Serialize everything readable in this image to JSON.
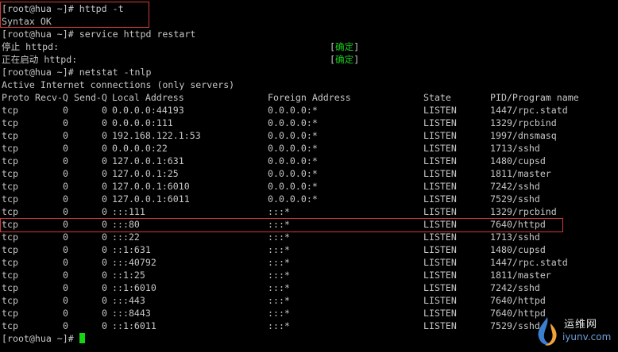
{
  "terminal": {
    "prompt": "[root@hua ~]#",
    "cmd1": "httpd -t",
    "syntax_ok": "Syntax OK",
    "cmd2": "service httpd restart",
    "stop_text": "停止 httpd:",
    "start_text": "正在启动 httpd:",
    "bracket_open": "[",
    "bracket_close": "]",
    "ok_word": "确定",
    "ok_color": "#19c81c",
    "cmd3": "netstat -tnlp",
    "active_text": "Active Internet connections (only servers)",
    "header": {
      "proto": "Proto",
      "recvq": "Recv-Q",
      "sendq": "Send-Q",
      "local": "Local Address",
      "foreign": "Foreign Address",
      "state": "State",
      "pid": "PID/Program name"
    },
    "rows": [
      {
        "proto": "tcp",
        "recv": "0",
        "send": "0",
        "local": "0.0.0.0:44193",
        "foreign": "0.0.0.0:*",
        "state": "LISTEN",
        "pid": "1447/rpc.statd"
      },
      {
        "proto": "tcp",
        "recv": "0",
        "send": "0",
        "local": "0.0.0.0:111",
        "foreign": "0.0.0.0:*",
        "state": "LISTEN",
        "pid": "1329/rpcbind"
      },
      {
        "proto": "tcp",
        "recv": "0",
        "send": "0",
        "local": "192.168.122.1:53",
        "foreign": "0.0.0.0:*",
        "state": "LISTEN",
        "pid": "1997/dnsmasq"
      },
      {
        "proto": "tcp",
        "recv": "0",
        "send": "0",
        "local": "0.0.0.0:22",
        "foreign": "0.0.0.0:*",
        "state": "LISTEN",
        "pid": "1713/sshd"
      },
      {
        "proto": "tcp",
        "recv": "0",
        "send": "0",
        "local": "127.0.0.1:631",
        "foreign": "0.0.0.0:*",
        "state": "LISTEN",
        "pid": "1480/cupsd"
      },
      {
        "proto": "tcp",
        "recv": "0",
        "send": "0",
        "local": "127.0.0.1:25",
        "foreign": "0.0.0.0:*",
        "state": "LISTEN",
        "pid": "1811/master"
      },
      {
        "proto": "tcp",
        "recv": "0",
        "send": "0",
        "local": "127.0.0.1:6010",
        "foreign": "0.0.0.0:*",
        "state": "LISTEN",
        "pid": "7242/sshd"
      },
      {
        "proto": "tcp",
        "recv": "0",
        "send": "0",
        "local": "127.0.0.1:6011",
        "foreign": "0.0.0.0:*",
        "state": "LISTEN",
        "pid": "7529/sshd"
      },
      {
        "proto": "tcp",
        "recv": "0",
        "send": "0",
        "local": ":::111",
        "foreign": ":::*",
        "state": "LISTEN",
        "pid": "1329/rpcbind"
      },
      {
        "proto": "tcp",
        "recv": "0",
        "send": "0",
        "local": ":::80",
        "foreign": ":::*",
        "state": "LISTEN",
        "pid": "7640/httpd"
      },
      {
        "proto": "tcp",
        "recv": "0",
        "send": "0",
        "local": ":::22",
        "foreign": ":::*",
        "state": "LISTEN",
        "pid": "1713/sshd"
      },
      {
        "proto": "tcp",
        "recv": "0",
        "send": "0",
        "local": "::1:631",
        "foreign": ":::*",
        "state": "LISTEN",
        "pid": "1480/cupsd"
      },
      {
        "proto": "tcp",
        "recv": "0",
        "send": "0",
        "local": ":::40792",
        "foreign": ":::*",
        "state": "LISTEN",
        "pid": "1447/rpc.statd"
      },
      {
        "proto": "tcp",
        "recv": "0",
        "send": "0",
        "local": "::1:25",
        "foreign": ":::*",
        "state": "LISTEN",
        "pid": "1811/master"
      },
      {
        "proto": "tcp",
        "recv": "0",
        "send": "0",
        "local": "::1:6010",
        "foreign": ":::*",
        "state": "LISTEN",
        "pid": "7242/sshd"
      },
      {
        "proto": "tcp",
        "recv": "0",
        "send": "0",
        "local": ":::443",
        "foreign": ":::*",
        "state": "LISTEN",
        "pid": "7640/httpd"
      },
      {
        "proto": "tcp",
        "recv": "0",
        "send": "0",
        "local": ":::8443",
        "foreign": ":::*",
        "state": "LISTEN",
        "pid": "7640/httpd"
      },
      {
        "proto": "tcp",
        "recv": "0",
        "send": "0",
        "local": "::1:6011",
        "foreign": ":::*",
        "state": "LISTEN",
        "pid": "7529/sshd"
      }
    ],
    "highlight_color": "#d23a3a",
    "cursor_color": "#13d713"
  },
  "watermark": {
    "name": "运维网",
    "domain": "iyunv.com",
    "icon": "iyunv-logo-icon"
  }
}
